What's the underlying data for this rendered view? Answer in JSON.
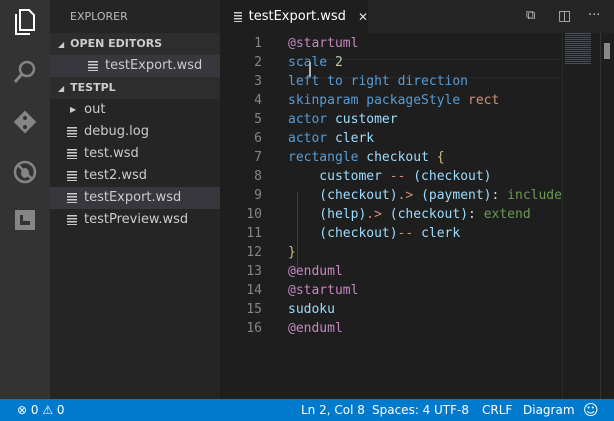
{
  "activity_bar": [
    "files-icon",
    "search-icon",
    "git-icon",
    "debug-icon",
    "extensions-icon"
  ],
  "sidebar": {
    "title": "EXPLORER",
    "open_editors": {
      "label": "OPEN EDITORS",
      "items": [
        "testExport.wsd"
      ]
    },
    "folder": {
      "label": "TESTPL",
      "folder_item": "out",
      "files": [
        "debug.log",
        "test.wsd",
        "test2.wsd",
        "testExport.wsd",
        "testPreview.wsd"
      ],
      "selected": "testExport.wsd"
    }
  },
  "tab": {
    "label": "testExport.wsd",
    "close": "✕"
  },
  "editor": {
    "current_line": 2,
    "lines": [
      [
        [
          "@startuml",
          "a"
        ]
      ],
      [
        [
          "scale ",
          "k"
        ],
        [
          "2",
          "n"
        ]
      ],
      [
        [
          "left to right direction",
          "k"
        ]
      ],
      [
        [
          "skinparam packageStyle ",
          "k"
        ],
        [
          "rect",
          "s"
        ]
      ],
      [
        [
          "actor ",
          "k"
        ],
        [
          "customer",
          "i"
        ]
      ],
      [
        [
          "actor ",
          "k"
        ],
        [
          "clerk",
          "i"
        ]
      ],
      [
        [
          "rectangle ",
          "k"
        ],
        [
          "checkout ",
          "i"
        ],
        [
          "{",
          "o"
        ]
      ],
      [
        [
          "    customer ",
          "i"
        ],
        [
          "-- ",
          "s"
        ],
        [
          "(checkout)",
          "i"
        ]
      ],
      [
        [
          "    (checkout)",
          "i"
        ],
        [
          ".> ",
          "s"
        ],
        [
          "(payment)",
          "i"
        ],
        [
          ": ",
          "p"
        ],
        [
          "include",
          "c"
        ]
      ],
      [
        [
          "    (help)",
          "i"
        ],
        [
          ".> ",
          "s"
        ],
        [
          "(checkout)",
          "i"
        ],
        [
          ": ",
          "p"
        ],
        [
          "extend",
          "c"
        ]
      ],
      [
        [
          "    (checkout)",
          "i"
        ],
        [
          "-- ",
          "s"
        ],
        [
          "clerk",
          "i"
        ]
      ],
      [
        [
          "}",
          "o"
        ]
      ],
      [
        [
          "@enduml",
          "a"
        ]
      ],
      [
        [
          "@startuml",
          "a"
        ]
      ],
      [
        [
          "sudoku",
          "i"
        ]
      ],
      [
        [
          "@enduml",
          "a"
        ]
      ]
    ]
  },
  "status": {
    "errors": "0",
    "warnings": "0",
    "position": "Ln 2, Col 8",
    "spaces": "Spaces: 4",
    "encoding": "UTF-8",
    "eol": "CRLF",
    "language": "Diagram"
  }
}
